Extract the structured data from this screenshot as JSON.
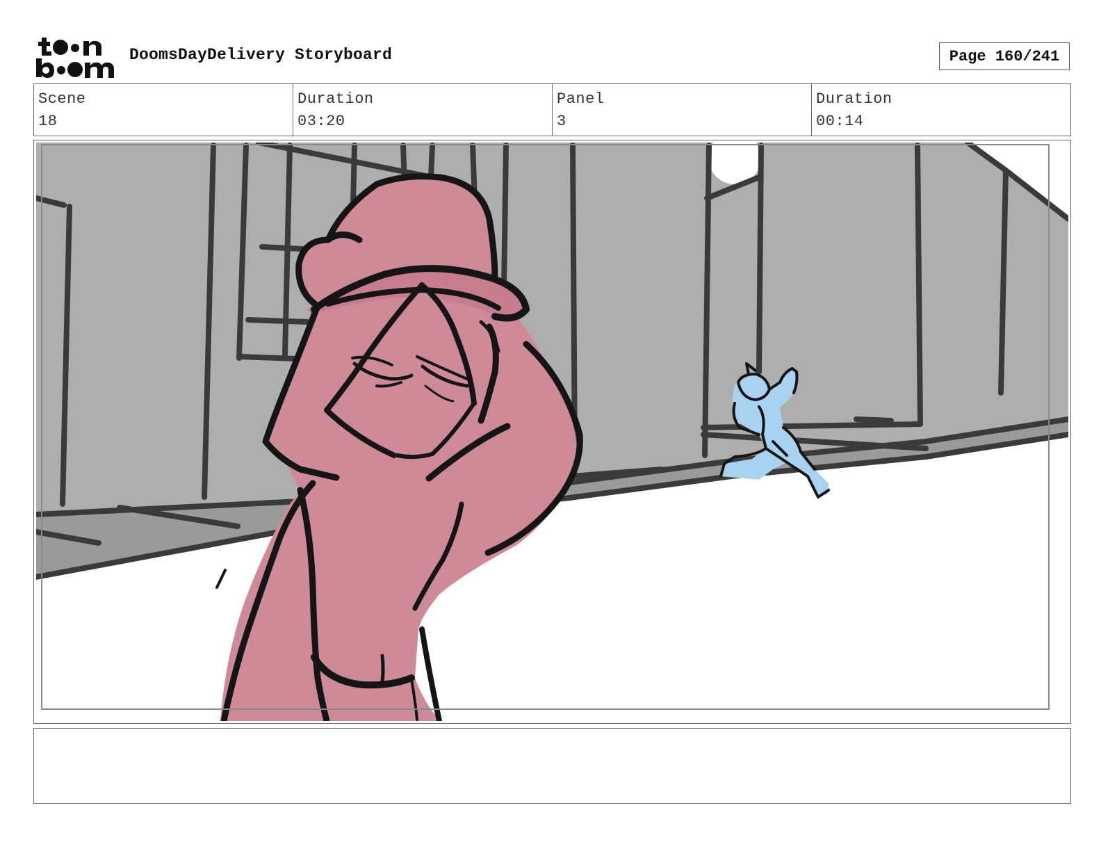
{
  "header": {
    "title": "DoomsDayDelivery Storyboard",
    "page_label": "Page 160/241",
    "logo_text": "toon boom"
  },
  "info": [
    {
      "label": "Scene",
      "value": "18"
    },
    {
      "label": "Duration",
      "value": "03:20"
    },
    {
      "label": "Panel",
      "value": "3"
    },
    {
      "label": "Duration",
      "value": "00:14"
    }
  ],
  "colors": {
    "building": "#aeaeae",
    "ink": "#151515",
    "character_main": "#cf8a98",
    "character_small": "#a9d1f0"
  }
}
